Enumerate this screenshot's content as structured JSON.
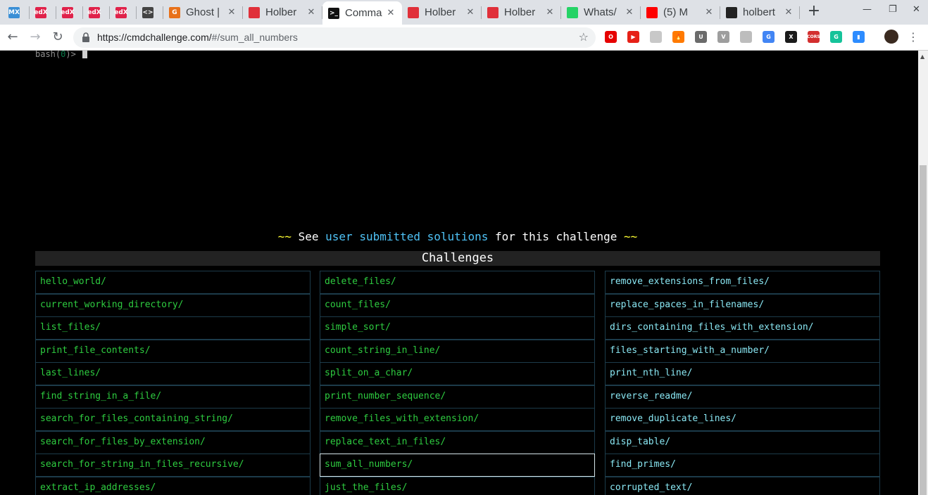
{
  "browser": {
    "tabs": [
      {
        "favicon": "mx-icon",
        "fav_text": "MX",
        "fav_color": "#3a8fd6",
        "title": ""
      },
      {
        "favicon": "edx-icon",
        "fav_text": "edX",
        "fav_color": "#e0224a",
        "title": ""
      },
      {
        "favicon": "edx-icon",
        "fav_text": "edX",
        "fav_color": "#e0224a",
        "title": ""
      },
      {
        "favicon": "edx-icon",
        "fav_text": "edX",
        "fav_color": "#e0224a",
        "title": ""
      },
      {
        "favicon": "edx-icon",
        "fav_text": "edX",
        "fav_color": "#e0224a",
        "title": ""
      },
      {
        "favicon": "code-icon",
        "fav_text": "<>",
        "fav_color": "#444444",
        "title": ""
      },
      {
        "favicon": "ghost-icon",
        "fav_text": "G",
        "fav_color": "#e8711a",
        "title": "Ghost |"
      },
      {
        "favicon": "holberton-icon",
        "fav_text": "",
        "fav_color": "#e0303a",
        "title": "Holber"
      },
      {
        "favicon": "terminal-icon",
        "fav_text": ">_",
        "fav_color": "#111111",
        "title": "Comma",
        "active": true
      },
      {
        "favicon": "holberton-icon",
        "fav_text": "",
        "fav_color": "#e0303a",
        "title": "Holber"
      },
      {
        "favicon": "holberton-icon",
        "fav_text": "",
        "fav_color": "#e0303a",
        "title": "Holber"
      },
      {
        "favicon": "whatsapp-icon",
        "fav_text": "",
        "fav_color": "#25d366",
        "title": "Whats/"
      },
      {
        "favicon": "youtube-icon",
        "fav_text": "",
        "fav_color": "#ff0000",
        "title": "(5) M"
      },
      {
        "favicon": "github-icon",
        "fav_text": "",
        "fav_color": "#222222",
        "title": "holbert"
      }
    ],
    "new_tab_label": "+",
    "close_glyph": "✕",
    "url_host": "https://cmdchallenge.com/",
    "url_path": "#/sum_all_numbers",
    "extensions": [
      {
        "name": "opera-extension-icon",
        "color": "#e60000",
        "text": "O"
      },
      {
        "name": "youtube-extension-icon",
        "color": "#e62117",
        "text": "▶"
      },
      {
        "name": "grid-extension-icon",
        "color": "#c8c8c8",
        "text": ""
      },
      {
        "name": "fire-extension-icon",
        "color": "#ff7a00",
        "text": "🔥"
      },
      {
        "name": "shield-extension-icon",
        "color": "#6b6b6b",
        "text": "U"
      },
      {
        "name": "vpn-extension-icon",
        "color": "#9e9e9e",
        "text": "V"
      },
      {
        "name": "camera-extension-icon",
        "color": "#bdbdbd",
        "text": ""
      },
      {
        "name": "translate-extension-icon",
        "color": "#4285f4",
        "text": "G"
      },
      {
        "name": "x-extension-icon",
        "color": "#1a1a1a",
        "text": "X"
      },
      {
        "name": "cors-extension-icon",
        "color": "#d32f2f",
        "text": "CORS"
      },
      {
        "name": "grammarly-extension-icon",
        "color": "#15c39a",
        "text": "G"
      },
      {
        "name": "zoom-extension-icon",
        "color": "#2d8cff",
        "text": "▮"
      },
      {
        "name": "profile-avatar-icon",
        "color": "#3a2a20",
        "text": ""
      }
    ]
  },
  "terminal": {
    "prompt_prefix": "bash(",
    "prompt_code": "0",
    "prompt_suffix": ")>"
  },
  "solutions_line": {
    "tilde_left": "~~",
    "see": " See ",
    "link": "user submitted solutions",
    "rest": " for this challenge ",
    "tilde_right": "~~"
  },
  "challenges": {
    "header": "Challenges",
    "columns": [
      {
        "color": "green",
        "items": [
          "hello_world/",
          "current_working_directory/",
          "list_files/",
          "print_file_contents/",
          "last_lines/",
          "find_string_in_a_file/",
          "search_for_files_containing_string/",
          "search_for_files_by_extension/",
          "search_for_string_in_files_recursive/",
          "extract_ip_addresses/"
        ]
      },
      {
        "color": "green",
        "items": [
          "delete_files/",
          "count_files/",
          "simple_sort/",
          "count_string_in_line/",
          "split_on_a_char/",
          "print_number_sequence/",
          "remove_files_with_extension/",
          "replace_text_in_files/",
          "sum_all_numbers/",
          "just_the_files/"
        ]
      },
      {
        "color": "cyan",
        "items": [
          "remove_extensions_from_files/",
          "replace_spaces_in_filenames/",
          "dirs_containing_files_with_extension/",
          "files_starting_with_a_number/",
          "print_nth_line/",
          "reverse_readme/",
          "remove_duplicate_lines/",
          "disp_table/",
          "find_primes/",
          "corrupted_text/"
        ]
      }
    ],
    "current": "sum_all_numbers/"
  }
}
